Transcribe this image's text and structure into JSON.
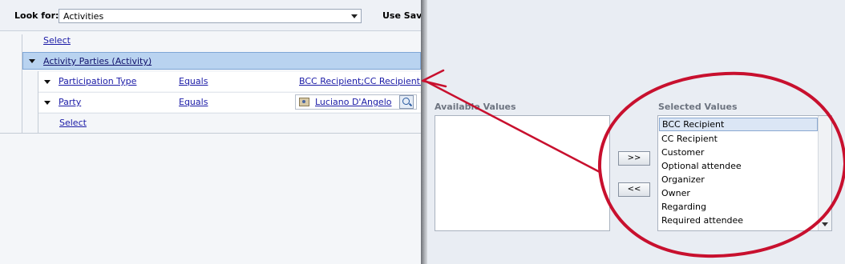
{
  "lookfor": {
    "label": "Look for:",
    "value": "Activities",
    "use_saved_label": "Use Save"
  },
  "criteria": {
    "select_top": "Select",
    "group_label": "Activity Parties (Activity)",
    "rows": [
      {
        "field": "Participation Type",
        "operator": "Equals",
        "value": "BCC Recipient;CC Recipient..."
      },
      {
        "field": "Party",
        "operator": "Equals",
        "value": "Luciano D'Angelo"
      }
    ],
    "select_bottom": "Select"
  },
  "dialog": {
    "available_label": "Available Values",
    "selected_label": "Selected Values",
    "add_button": ">>",
    "remove_button": "<<",
    "selected_values": [
      "BCC Recipient",
      "CC Recipient",
      "Customer",
      "Optional attendee",
      "Organizer",
      "Owner",
      "Regarding",
      "Required attendee"
    ]
  },
  "annotation": {
    "color": "#c8102e"
  }
}
